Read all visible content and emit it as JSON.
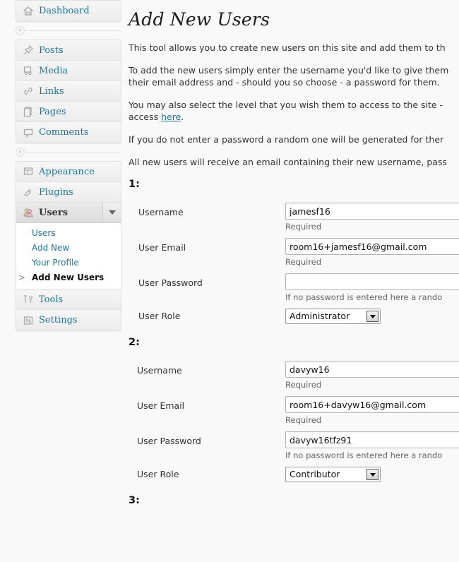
{
  "sidebar": {
    "groups": [
      {
        "items": [
          {
            "label": "Dashboard",
            "icon": "dashboard-icon",
            "current": false
          }
        ]
      },
      {
        "items": [
          {
            "label": "Posts",
            "icon": "pin-icon",
            "current": false
          },
          {
            "label": "Media",
            "icon": "media-icon",
            "current": false
          },
          {
            "label": "Links",
            "icon": "link-icon",
            "current": false
          },
          {
            "label": "Pages",
            "icon": "pages-icon",
            "current": false
          },
          {
            "label": "Comments",
            "icon": "comments-icon",
            "current": false
          }
        ]
      },
      {
        "items": [
          {
            "label": "Appearance",
            "icon": "appearance-icon",
            "current": false
          },
          {
            "label": "Plugins",
            "icon": "plugins-icon",
            "current": false
          },
          {
            "label": "Users",
            "icon": "users-icon",
            "current": true
          },
          {
            "label": "Tools",
            "icon": "tools-icon",
            "current": false
          },
          {
            "label": "Settings",
            "icon": "settings-icon",
            "current": false
          }
        ]
      }
    ],
    "submenu": [
      {
        "label": "Users",
        "active": false
      },
      {
        "label": "Add New",
        "active": false
      },
      {
        "label": "Your Profile",
        "active": false
      },
      {
        "label": "Add New Users",
        "active": true
      }
    ],
    "collapse_glyph": "«"
  },
  "page": {
    "title": "Add New Users",
    "paragraphs": [
      "This tool allows you to create new users on this site and add them to th",
      "To add the new users simply enter the username you'd like to give them\ntheir email address and - should you so choose - a password for them.",
      "You may also select the level that you wish them to access to the site -\naccess ",
      "If you do not enter a password a random one will be generated for ther",
      "All new users will receive an email containing their new username, pass"
    ],
    "link_text": "here",
    "link_suffix": "."
  },
  "form": {
    "labels": {
      "username": "Username",
      "email": "User Email",
      "password": "User Password",
      "role": "User Role"
    },
    "hints": {
      "required": "Required",
      "password": "If no password is entered here a rando"
    },
    "users": [
      {
        "number": "1:",
        "username": "jamesf16",
        "email": "room16+jamesf16@gmail.com",
        "password": "",
        "role": "Administrator"
      },
      {
        "number": "2:",
        "username": "davyw16",
        "email": "room16+davyw16@gmail.com",
        "password": "davyw16tfz91",
        "role": "Contributor"
      },
      {
        "number": "3:",
        "username": "",
        "email": "",
        "password": "",
        "role": ""
      }
    ]
  },
  "colors": {
    "link": "#21759b",
    "text": "#333333",
    "background": "#f9f9f9",
    "panel": "#f1f1f1",
    "border": "#dfdfdf"
  }
}
